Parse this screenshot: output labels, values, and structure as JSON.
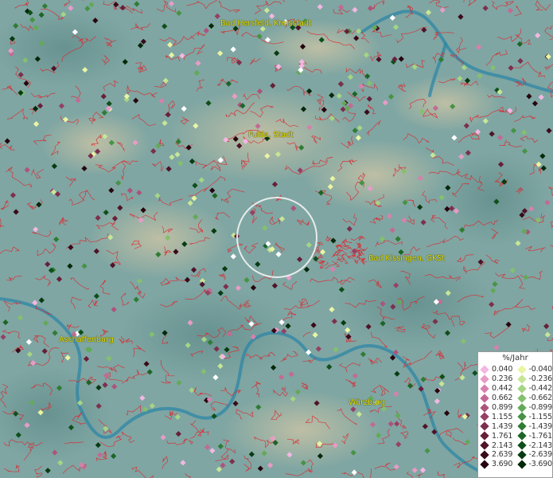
{
  "map": {
    "place_labels": [
      "Bad Hersfeld, Kreisstadt",
      "Fulda, Stadt",
      "Bad Kissingen, GKSt",
      "Aschaffenburg",
      "Würzburg"
    ]
  },
  "legend": {
    "title": "%/Jahr",
    "positive": [
      {
        "value": "0.040",
        "color": "#f3b7e3"
      },
      {
        "value": "0.236",
        "color": "#e79cc7"
      },
      {
        "value": "0.442",
        "color": "#d681ad"
      },
      {
        "value": "0.662",
        "color": "#c26a94"
      },
      {
        "value": "0.899",
        "color": "#ad547b"
      },
      {
        "value": "1.155",
        "color": "#964164"
      },
      {
        "value": "1.439",
        "color": "#7e2f4d"
      },
      {
        "value": "1.761",
        "color": "#671f39"
      },
      {
        "value": "2.143",
        "color": "#501327"
      },
      {
        "value": "2.639",
        "color": "#3a0a19"
      },
      {
        "value": "3.690",
        "color": "#26050e"
      }
    ],
    "negative": [
      {
        "value": "-0.040",
        "color": "#e9f5a3"
      },
      {
        "value": "-0.236",
        "color": "#c7e695"
      },
      {
        "value": "-0.442",
        "color": "#a5d585"
      },
      {
        "value": "-0.662",
        "color": "#84c06f"
      },
      {
        "value": "-0.899",
        "color": "#63a958"
      },
      {
        "value": "-1.155",
        "color": "#479345"
      },
      {
        "value": "-1.439",
        "color": "#2f7c34"
      },
      {
        "value": "-1.761",
        "color": "#1c6526"
      },
      {
        "value": "-2.143",
        "color": "#0f4f1a"
      },
      {
        "value": "-2.639",
        "color": "#083b11"
      },
      {
        "value": "-3.690",
        "color": "#042809"
      }
    ]
  }
}
